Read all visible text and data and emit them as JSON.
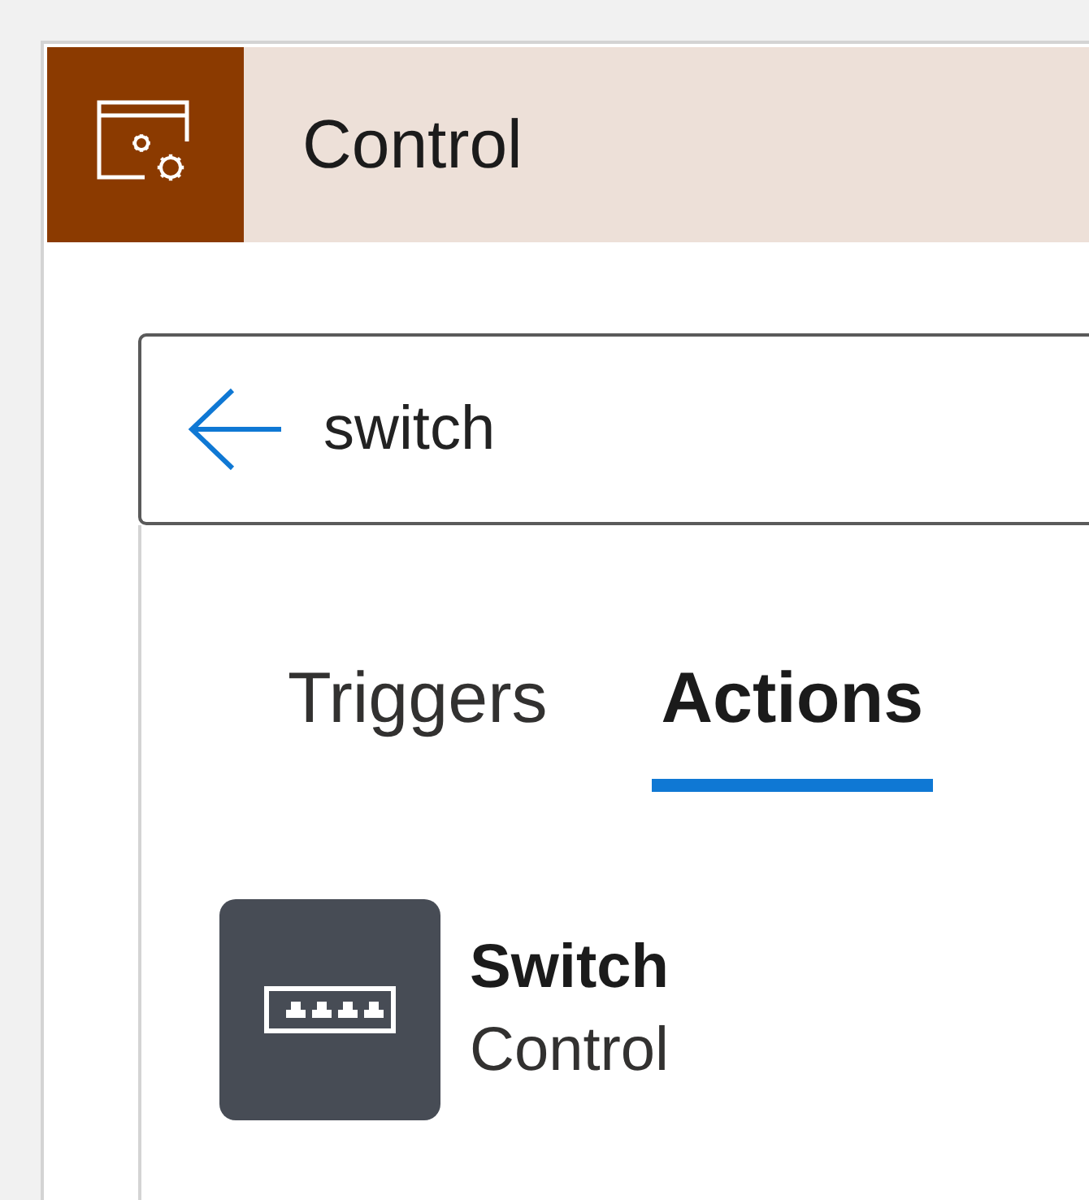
{
  "header": {
    "title": "Control"
  },
  "search": {
    "value": "switch"
  },
  "tabs": [
    {
      "label": "Triggers",
      "selected": false
    },
    {
      "label": "Actions",
      "selected": true
    }
  ],
  "results": [
    {
      "title": "Switch",
      "subtitle": "Control"
    }
  ]
}
